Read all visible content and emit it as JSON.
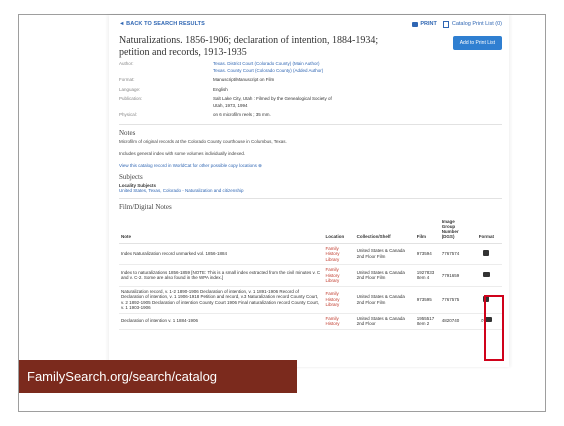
{
  "header": {
    "back_label": "◄ BACK TO SEARCH RESULTS",
    "print_label": "PRINT",
    "catalog_print_list": "Catalog Print List (0)"
  },
  "record": {
    "title": "Naturalizations. 1856-1906; declaration of intention, 1884-1934; petition and records, 1913-1935",
    "add_button": "Add to Print List",
    "details": [
      {
        "label": "Author:",
        "value": "Texas. District Court (Colorado County) (Main Author)",
        "value2": "Texas. County Court (Colorado County) (Added Author)"
      },
      {
        "label": "Format:",
        "value": "Manuscript/Manuscript on Film"
      },
      {
        "label": "Language:",
        "value": "English"
      },
      {
        "label": "Publication:",
        "value": "Salt Lake City, Utah : Filmed by the Genealogical Society of Utah, 1973, 1994"
      },
      {
        "label": "Physical:",
        "value": "on 6 microfilm reels ; 35 mm."
      }
    ]
  },
  "notes": {
    "heading": "Notes",
    "line1": "Microfilm of original records at the Colorado County courthouse in Columbus, Texas.",
    "line2": "Includes general index with some volumes individually indexed.",
    "worldcat_link": "View this catalog record in WorldCat for other possible copy locations"
  },
  "subjects": {
    "heading": "Subjects",
    "subheading": "Locality Subjects",
    "link": "United States, Texas, Colorado - Naturalization and citizenship"
  },
  "film": {
    "heading": "Film/Digital Notes",
    "columns": {
      "note": "Note",
      "location": "Location",
      "shelf": "Collection/Shelf",
      "film": "Film",
      "image_group": "Image Group Number (DGS)",
      "format": "Format"
    },
    "rows": [
      {
        "note": "Index Naturalization record unmarked vol. 1856-1884",
        "location": "Family History Library",
        "shelf": "United States & Canada 2nd Floor Film",
        "film": "973594",
        "img": "7767574"
      },
      {
        "note": "Index to naturalizations 1856-1859 [NOTE: This is a small index extracted from the civil minutes v. C and v. C-2. Some are also found in the WPA index.]",
        "location": "Family History Library",
        "shelf": "United States & Canada 2nd Floor Film",
        "film": "1927833 Item 4",
        "img": "7791659"
      },
      {
        "note": "Naturalization record, v. 1-2 1890-1906 Declaration of intention, v. 1 1891-1906 Record of Declaration of intention, v. 1 1906-1918 Petition and record, v.3 Naturalization record County Court, v. 2 1892-1905 Declaration of intention County Court 1906 Final naturalization record County Court, v. 1 1903-1906",
        "location": "Family History Library",
        "shelf": "United States & Canada 2nd Floor Film",
        "film": "973595",
        "img": "7767575"
      },
      {
        "note": "Declaration of intention v. 1 1884-1906",
        "location": "Family History",
        "shelf": "United States & Canada 2nd Floor",
        "film": "1955517 Item 2",
        "img": "4820740"
      }
    ]
  },
  "caption": "FamilySearch.org/search/catalog",
  "colors": {
    "link": "#2f66b3",
    "location": "#c0392b",
    "banner": "#7b2a1d",
    "highlight": "#d0021b"
  }
}
